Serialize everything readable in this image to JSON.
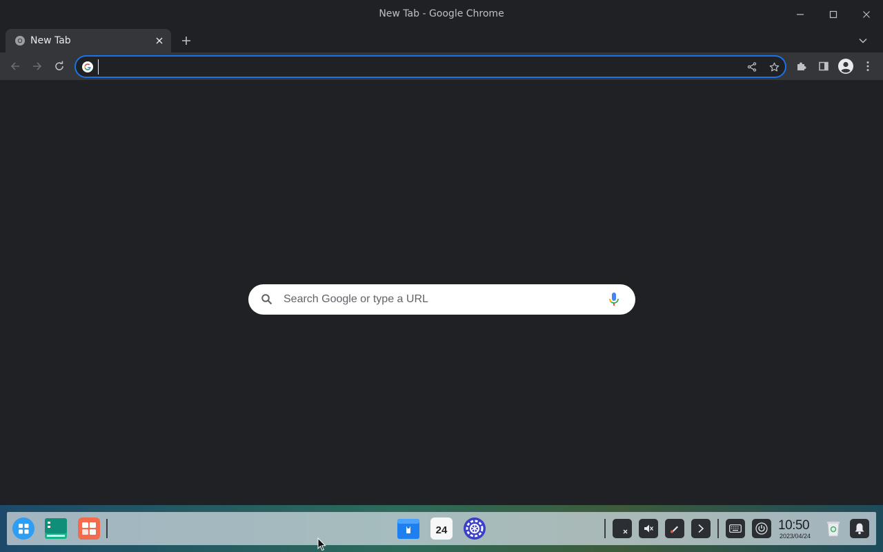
{
  "window": {
    "title": "New Tab - Google Chrome"
  },
  "tabs": [
    {
      "title": "New Tab",
      "active": true
    }
  ],
  "omnibox": {
    "value": "",
    "placeholder": ""
  },
  "ntp": {
    "search_placeholder": "Search Google or type a URL"
  },
  "taskbar": {
    "clock_time": "10:50",
    "clock_date": "2023/04/24",
    "calendar_day": "24",
    "apps": [
      "launcher-icon",
      "terminal-icon",
      "app-store-icon",
      "file-manager-icon",
      "calendar-icon",
      "settings-icon"
    ],
    "tray": [
      "screen-record-icon",
      "volume-muted-icon",
      "pen-icon",
      "chevron-right-icon",
      "keyboard-icon",
      "power-icon",
      "trash-icon",
      "bell-icon"
    ]
  },
  "colors": {
    "accent": "#1a73e8",
    "background": "#202124",
    "toolbar": "#35363a"
  }
}
